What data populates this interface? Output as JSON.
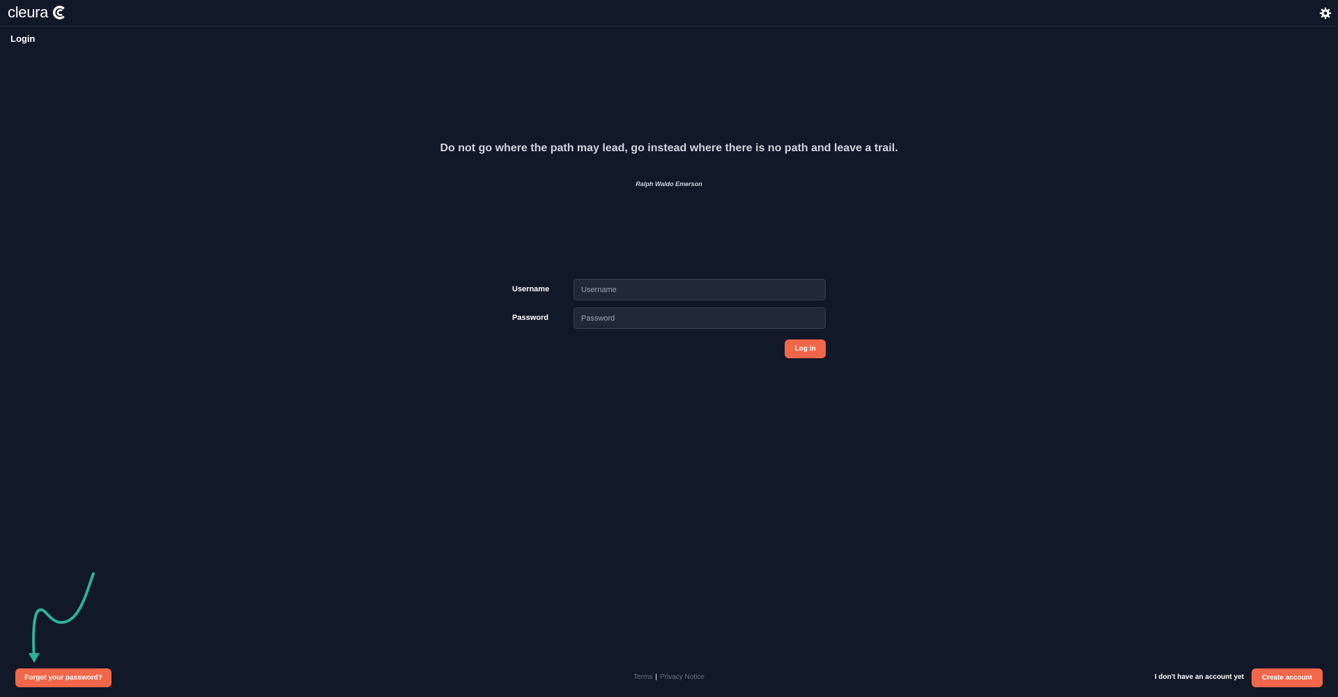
{
  "header": {
    "logo_text": "cleura",
    "settings_icon": "gear-icon"
  },
  "page": {
    "title": "Login"
  },
  "quote": {
    "text": "Do not go where the path may lead, go instead where there is no path and leave a trail.",
    "author": "Ralph Waldo Emerson"
  },
  "form": {
    "username_label": "Username",
    "username_placeholder": "Username",
    "username_value": "",
    "password_label": "Password",
    "password_placeholder": "Password",
    "password_value": "",
    "login_label": "Log in"
  },
  "footer": {
    "forgot_label": "Forgot your password?",
    "terms_label": "Terms",
    "separator": "|",
    "privacy_label": "Privacy Notice",
    "no_account_text": "I don't have an account yet",
    "create_label": "Create account"
  },
  "colors": {
    "background": "#111827",
    "accent": "#f26649",
    "annotation_arrow": "#2bb39a"
  }
}
